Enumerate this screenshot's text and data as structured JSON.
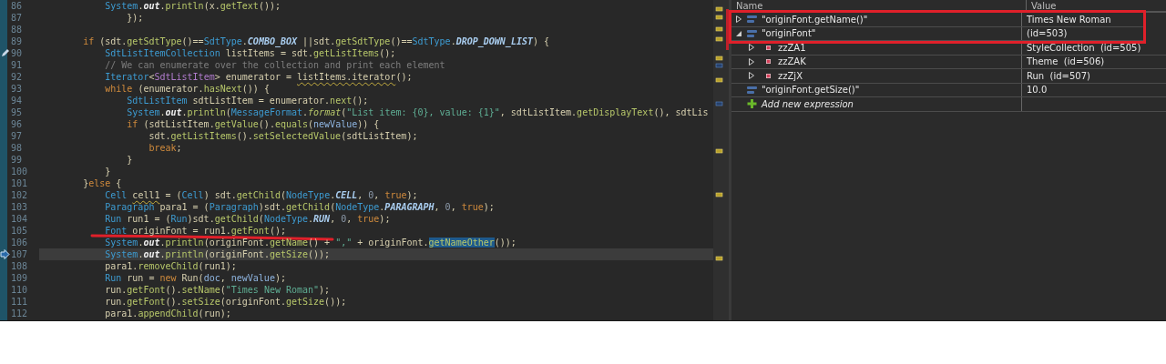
{
  "editor": {
    "lines": [
      {
        "number": "86",
        "kind": "code",
        "tokens": [
          {
            "kind": "type",
            "text": "            System"
          },
          {
            "kind": "plain",
            "text": "."
          },
          {
            "kind": "static",
            "text": "out"
          },
          {
            "kind": "plain",
            "text": "."
          },
          {
            "kind": "method",
            "text": "println"
          },
          {
            "kind": "plain",
            "text": "(x."
          },
          {
            "kind": "method",
            "text": "getText"
          },
          {
            "kind": "plain",
            "text": "());"
          }
        ]
      },
      {
        "number": "87",
        "kind": "code",
        "tokens": [
          {
            "kind": "plain",
            "text": "                });"
          }
        ]
      },
      {
        "number": "88",
        "kind": "code"
      },
      {
        "number": "89",
        "kind": "code",
        "tokens": [
          {
            "kind": "keyword",
            "text": "        if"
          },
          {
            "kind": "plain",
            "text": " (sdt."
          },
          {
            "kind": "method",
            "text": "getSdtType"
          },
          {
            "kind": "plain",
            "text": "()=="
          },
          {
            "kind": "type",
            "text": "SdtType"
          },
          {
            "kind": "plain",
            "text": "."
          },
          {
            "kind": "constant",
            "text": "COMBO_BOX"
          },
          {
            "kind": "plain",
            "text": " ||sdt."
          },
          {
            "kind": "method",
            "text": "getSdtType"
          },
          {
            "kind": "plain",
            "text": "()=="
          },
          {
            "kind": "type",
            "text": "SdtType"
          },
          {
            "kind": "plain",
            "text": "."
          },
          {
            "kind": "constant",
            "text": "DROP_DOWN_LIST"
          },
          {
            "kind": "plain",
            "text": ") {"
          }
        ]
      },
      {
        "number": "90",
        "kind": "changed",
        "tokens": [
          {
            "kind": "type",
            "text": "            SdtListItemCollection"
          },
          {
            "kind": "plain",
            "text": " listItems = sdt."
          },
          {
            "kind": "method",
            "text": "getListItems"
          },
          {
            "kind": "plain",
            "text": "();"
          }
        ]
      },
      {
        "number": "91",
        "kind": "code",
        "tokens": [
          {
            "kind": "comment",
            "text": "            // We can enumerate over the collection and print each element"
          }
        ]
      },
      {
        "number": "92",
        "kind": "code",
        "tokens": [
          {
            "kind": "type",
            "text": "            Iterator"
          },
          {
            "kind": "plain",
            "text": "<"
          },
          {
            "kind": "typeparam",
            "text": "SdtListItem"
          },
          {
            "kind": "plain",
            "text": "> enumerator = "
          },
          {
            "kind": "warning",
            "text": "listItems.iterator"
          },
          {
            "kind": "plain",
            "text": "();"
          }
        ]
      },
      {
        "number": "93",
        "kind": "code",
        "tokens": [
          {
            "kind": "keyword",
            "text": "            while"
          },
          {
            "kind": "plain",
            "text": " (enumerator."
          },
          {
            "kind": "method",
            "text": "hasNext"
          },
          {
            "kind": "plain",
            "text": "()) {"
          }
        ]
      },
      {
        "number": "94",
        "kind": "code",
        "tokens": [
          {
            "kind": "type",
            "text": "                SdtListItem"
          },
          {
            "kind": "plain",
            "text": " sdtListItem = enumerator."
          },
          {
            "kind": "method",
            "text": "next"
          },
          {
            "kind": "plain",
            "text": "();"
          }
        ]
      },
      {
        "number": "95",
        "kind": "code",
        "tokens": [
          {
            "kind": "type",
            "text": "                System"
          },
          {
            "kind": "plain",
            "text": "."
          },
          {
            "kind": "static",
            "text": "out"
          },
          {
            "kind": "plain",
            "text": "."
          },
          {
            "kind": "method",
            "text": "println"
          },
          {
            "kind": "plain",
            "text": "("
          },
          {
            "kind": "type",
            "text": "MessageFormat"
          },
          {
            "kind": "plain",
            "text": "."
          },
          {
            "kind": "staticmethod",
            "text": "format"
          },
          {
            "kind": "plain",
            "text": "("
          },
          {
            "kind": "string",
            "text": "\"List item: {0}, value: {1}\""
          },
          {
            "kind": "plain",
            "text": ", sdtListItem."
          },
          {
            "kind": "method",
            "text": "getDisplayText"
          },
          {
            "kind": "plain",
            "text": "(), sdtLis"
          }
        ]
      },
      {
        "number": "96",
        "kind": "code",
        "tokens": [
          {
            "kind": "keyword",
            "text": "                if"
          },
          {
            "kind": "plain",
            "text": " (sdtListItem."
          },
          {
            "kind": "method",
            "text": "getValue"
          },
          {
            "kind": "plain",
            "text": "()."
          },
          {
            "kind": "method",
            "text": "equals"
          },
          {
            "kind": "plain",
            "text": "("
          },
          {
            "kind": "param",
            "text": "newValue"
          },
          {
            "kind": "plain",
            "text": ")) {"
          }
        ]
      },
      {
        "number": "97",
        "kind": "code",
        "tokens": [
          {
            "kind": "plain",
            "text": "                    sdt."
          },
          {
            "kind": "method",
            "text": "getListItems"
          },
          {
            "kind": "plain",
            "text": "()."
          },
          {
            "kind": "method",
            "text": "setSelectedValue"
          },
          {
            "kind": "plain",
            "text": "(sdtListItem);"
          }
        ]
      },
      {
        "number": "98",
        "kind": "code",
        "tokens": [
          {
            "kind": "keyword",
            "text": "                    break"
          },
          {
            "kind": "plain",
            "text": ";"
          }
        ]
      },
      {
        "number": "99",
        "kind": "code",
        "tokens": [
          {
            "kind": "plain",
            "text": "                }"
          }
        ]
      },
      {
        "number": "100",
        "kind": "code",
        "tokens": [
          {
            "kind": "plain",
            "text": "            }"
          }
        ]
      },
      {
        "number": "101",
        "kind": "code",
        "tokens": [
          {
            "kind": "plain",
            "text": "        }"
          },
          {
            "kind": "keyword",
            "text": "else"
          },
          {
            "kind": "plain",
            "text": " {"
          }
        ]
      },
      {
        "number": "102",
        "kind": "code",
        "tokens": [
          {
            "kind": "type",
            "text": "            Cell "
          },
          {
            "kind": "warning",
            "text": "cell1"
          },
          {
            "kind": "plain",
            "text": " = ("
          },
          {
            "kind": "type",
            "text": "Cell"
          },
          {
            "kind": "plain",
            "text": ") sdt."
          },
          {
            "kind": "method",
            "text": "getChild"
          },
          {
            "kind": "plain",
            "text": "("
          },
          {
            "kind": "type",
            "text": "NodeType"
          },
          {
            "kind": "plain",
            "text": "."
          },
          {
            "kind": "constant",
            "text": "CELL"
          },
          {
            "kind": "plain",
            "text": ", "
          },
          {
            "kind": "number",
            "text": "0"
          },
          {
            "kind": "plain",
            "text": ", "
          },
          {
            "kind": "keyword",
            "text": "true"
          },
          {
            "kind": "plain",
            "text": ");"
          }
        ]
      },
      {
        "number": "103",
        "kind": "code",
        "tokens": [
          {
            "kind": "type",
            "text": "            Paragraph"
          },
          {
            "kind": "plain",
            "text": " para1 = ("
          },
          {
            "kind": "type",
            "text": "Paragraph"
          },
          {
            "kind": "plain",
            "text": ")sdt."
          },
          {
            "kind": "method",
            "text": "getChild"
          },
          {
            "kind": "plain",
            "text": "("
          },
          {
            "kind": "type",
            "text": "NodeType"
          },
          {
            "kind": "plain",
            "text": "."
          },
          {
            "kind": "constant",
            "text": "PARAGRAPH"
          },
          {
            "kind": "plain",
            "text": ", "
          },
          {
            "kind": "number",
            "text": "0"
          },
          {
            "kind": "plain",
            "text": ", "
          },
          {
            "kind": "keyword",
            "text": "true"
          },
          {
            "kind": "plain",
            "text": ");"
          }
        ]
      },
      {
        "number": "104",
        "kind": "code",
        "tokens": [
          {
            "kind": "type",
            "text": "            Run"
          },
          {
            "kind": "plain",
            "text": " run1 = ("
          },
          {
            "kind": "type",
            "text": "Run"
          },
          {
            "kind": "plain",
            "text": ")sdt."
          },
          {
            "kind": "method",
            "text": "getChild"
          },
          {
            "kind": "plain",
            "text": "("
          },
          {
            "kind": "type",
            "text": "NodeType"
          },
          {
            "kind": "plain",
            "text": "."
          },
          {
            "kind": "constant",
            "text": "RUN"
          },
          {
            "kind": "plain",
            "text": ", "
          },
          {
            "kind": "number",
            "text": "0"
          },
          {
            "kind": "plain",
            "text": ", "
          },
          {
            "kind": "keyword",
            "text": "true"
          },
          {
            "kind": "plain",
            "text": ");"
          }
        ]
      },
      {
        "number": "105",
        "kind": "code",
        "underlined": true,
        "tokens": [
          {
            "kind": "type",
            "text": "            Font"
          },
          {
            "kind": "plain",
            "text": " originFont = run1."
          },
          {
            "kind": "method",
            "text": "getFont"
          },
          {
            "kind": "plain",
            "text": "();"
          }
        ]
      },
      {
        "number": "106",
        "kind": "code",
        "tokens": [
          {
            "kind": "type",
            "text": "            System"
          },
          {
            "kind": "plain",
            "text": "."
          },
          {
            "kind": "static",
            "text": "out"
          },
          {
            "kind": "plain",
            "text": "."
          },
          {
            "kind": "method",
            "text": "println"
          },
          {
            "kind": "plain",
            "text": "(originFont."
          },
          {
            "kind": "method",
            "text": "getName"
          },
          {
            "kind": "plain",
            "text": "() + "
          },
          {
            "kind": "string",
            "text": "\",\""
          },
          {
            "kind": "plain",
            "text": " + originFont."
          },
          {
            "kind": "match",
            "text": "getNameOther"
          },
          {
            "kind": "plain",
            "text": "());"
          }
        ]
      },
      {
        "number": "107",
        "kind": "current",
        "tokens": [
          {
            "kind": "type",
            "text": "            System"
          },
          {
            "kind": "plain",
            "text": "."
          },
          {
            "kind": "static",
            "text": "out"
          },
          {
            "kind": "plain",
            "text": "."
          },
          {
            "kind": "method",
            "text": "println"
          },
          {
            "kind": "plain",
            "text": "(originFont."
          },
          {
            "kind": "method",
            "text": "getSize"
          },
          {
            "kind": "plain",
            "text": "());"
          }
        ]
      },
      {
        "number": "108",
        "kind": "code",
        "tokens": [
          {
            "kind": "plain",
            "text": "            para1."
          },
          {
            "kind": "method",
            "text": "removeChild"
          },
          {
            "kind": "plain",
            "text": "(run1);"
          }
        ]
      },
      {
        "number": "109",
        "kind": "code",
        "tokens": [
          {
            "kind": "type",
            "text": "            Run"
          },
          {
            "kind": "plain",
            "text": " run = "
          },
          {
            "kind": "keyword",
            "text": "new"
          },
          {
            "kind": "plain",
            "text": " Run("
          },
          {
            "kind": "param",
            "text": "doc"
          },
          {
            "kind": "plain",
            "text": ", "
          },
          {
            "kind": "param",
            "text": "newValue"
          },
          {
            "kind": "plain",
            "text": ");"
          }
        ]
      },
      {
        "number": "110",
        "kind": "code",
        "tokens": [
          {
            "kind": "plain",
            "text": "            run."
          },
          {
            "kind": "method",
            "text": "getFont"
          },
          {
            "kind": "plain",
            "text": "()."
          },
          {
            "kind": "method",
            "text": "setName"
          },
          {
            "kind": "plain",
            "text": "("
          },
          {
            "kind": "string",
            "text": "\"Times New Roman\""
          },
          {
            "kind": "plain",
            "text": ");"
          }
        ]
      },
      {
        "number": "111",
        "kind": "code",
        "tokens": [
          {
            "kind": "plain",
            "text": "            run."
          },
          {
            "kind": "method",
            "text": "getFont"
          },
          {
            "kind": "plain",
            "text": "()."
          },
          {
            "kind": "method",
            "text": "setSize"
          },
          {
            "kind": "plain",
            "text": "(originFont."
          },
          {
            "kind": "method",
            "text": "getSize"
          },
          {
            "kind": "plain",
            "text": "());"
          }
        ]
      },
      {
        "number": "112",
        "kind": "code",
        "tokens": [
          {
            "kind": "plain",
            "text": "            para1."
          },
          {
            "kind": "method",
            "text": "appendChild"
          },
          {
            "kind": "plain",
            "text": "(run);"
          }
        ]
      }
    ]
  },
  "expressions": {
    "columns": [
      "Name",
      "Value"
    ],
    "rows": [
      {
        "kind": "watch",
        "name": "\"originFont.getName()\"",
        "value": "Times New Roman",
        "expanded": false,
        "framed": true
      },
      {
        "kind": "watch",
        "name": "\"originFont\"",
        "value": "(id=503)",
        "expanded": true,
        "framed": true,
        "children": [
          {
            "kind": "field",
            "name": "zzZA1",
            "value": "StyleCollection  (id=505)",
            "expanded": false
          },
          {
            "kind": "field",
            "name": "zzZAK",
            "value": "Theme  (id=506)",
            "expanded": false
          },
          {
            "kind": "field",
            "name": "zzZjX",
            "value": "Run  (id=507)",
            "expanded": false
          }
        ]
      },
      {
        "kind": "watch",
        "name": "\"originFont.getSize()\"",
        "value": "10.0"
      },
      {
        "kind": "add",
        "name": "Add new expression"
      }
    ]
  }
}
